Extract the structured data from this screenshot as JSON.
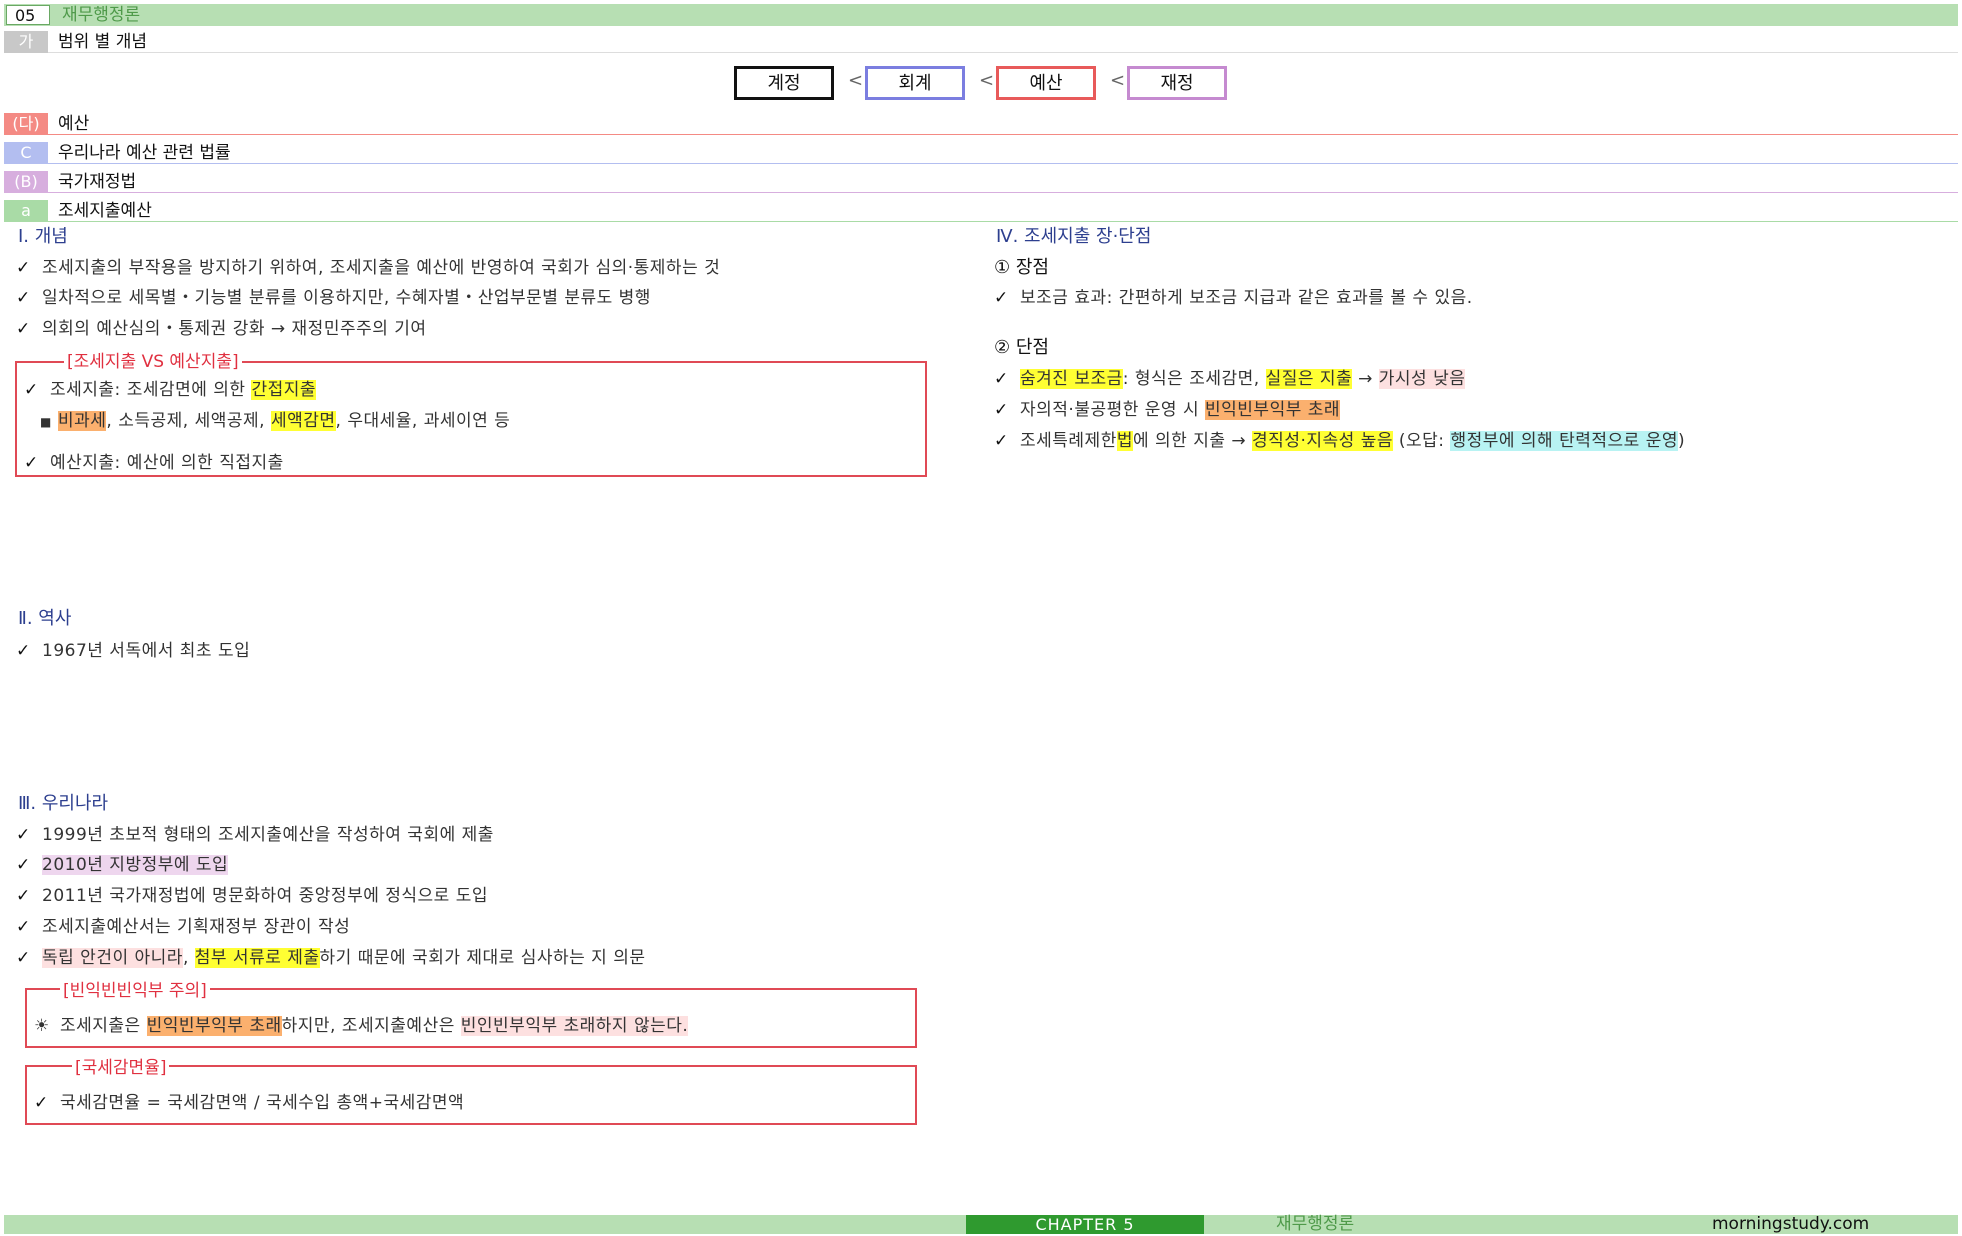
{
  "header": {
    "chapter_num": "05",
    "subject": "재무행정론"
  },
  "sections": [
    {
      "tag": "가",
      "label": "범위 별 개념",
      "color": "#c8c8c8"
    },
    {
      "tag": "(다)",
      "label": "예산",
      "color": "#f48a84"
    },
    {
      "tag": "C",
      "label": "우리나라 예산 관련 법률",
      "color": "#b3bef0"
    },
    {
      "tag": "(B)",
      "label": "국가재정법",
      "color": "#d7aede"
    },
    {
      "tag": "a",
      "label": "조세지출예산",
      "color": "#a9dba6"
    }
  ],
  "hierarchy": {
    "items": [
      {
        "label": "계정",
        "color": "#111111"
      },
      {
        "label": "회계",
        "color": "#7b7ee0"
      },
      {
        "label": "예산",
        "color": "#e85a5a"
      },
      {
        "label": "재정",
        "color": "#c58ad0"
      }
    ],
    "sep": "<"
  },
  "concept": {
    "heading": "Ⅰ. 개념",
    "items": [
      "조세지출의 부작용을 방지하기 위하여, 조세지출을 예산에 반영하여 국회가 심의·통제하는 것",
      "일차적으로 세목별・기능별 분류를 이용하지만, 수혜자별・산업부문별 분류도 병행",
      "의회의 예산심의・통제권 강화 → 재정민주주의 기여"
    ],
    "box": {
      "title": "[조세지출 VS 예산지출]",
      "line1": {
        "a": "조세지출: 조세감면에 의한 ",
        "b": "간접지출"
      },
      "line2": {
        "a": "비과세",
        "b": ", 소득공제, 세액공제, ",
        "c": "세액감면",
        "d": ", 우대세율, 과세이연 등"
      },
      "line3": "예산지출: 예산에 의한 직접지출"
    }
  },
  "history": {
    "heading": "Ⅱ. 역사",
    "items": [
      "1967년 서독에서 최초 도입"
    ]
  },
  "korea": {
    "heading": "Ⅲ. 우리나라",
    "items": [
      "1999년 초보적 형태의 조세지출예산을 작성하여 국회에 제출",
      "2010년 지방정부에 도입",
      "2011년 국가재정법에 명문화하여 중앙정부에 정식으로 도입",
      "조세지출예산서는 기획재정부 장관이 작성"
    ],
    "item5": {
      "a": "독립 안건이 아니라",
      "b": ", ",
      "c": "첨부 서류로 제출",
      "d": "하기 때문에 국회가 제대로 심사하는 지 의문"
    },
    "box1": {
      "title": "[빈익빈빈익부 주의]",
      "bullet": "☀",
      "a": "조세지출은 ",
      "b": "빈익빈부익부 초래",
      "c": "하지만, 조세지출예산은 ",
      "d": "빈인빈부익부 초래하지 않는다."
    },
    "box2": {
      "title": "[국세감면율]",
      "text": "국세감면율 = 국세감면액 / 국세수입 총액+국세감면액"
    }
  },
  "proscons": {
    "heading": "Ⅳ. 조세지출 장·단점",
    "pros_title": "① 장점",
    "pros_item": "보조금 효과: 간편하게 보조금 지급과 같은 효과를 볼 수 있음.",
    "cons_title": "② 단점",
    "cons1": {
      "a": "숨겨진 보조금",
      "b": ": 형식은 조세감면, ",
      "c": "실질은 지출",
      "d": " → ",
      "e": "가시성 낮음"
    },
    "cons2": {
      "a": "자의적·불공평한 운영 시 ",
      "b": "빈익빈부익부 초래"
    },
    "cons3": {
      "a": "조세특례제한",
      "b": "법",
      "c": "에 의한 지출 → ",
      "d": "경직성·지속성 높음",
      "e": " (오답: ",
      "f": "행정부에 의해 탄력적으로 운영",
      "g": ")"
    }
  },
  "footer": {
    "chapter": "CHAPTER 5",
    "subject": "재무행정론",
    "site": "morningstudy.com"
  }
}
